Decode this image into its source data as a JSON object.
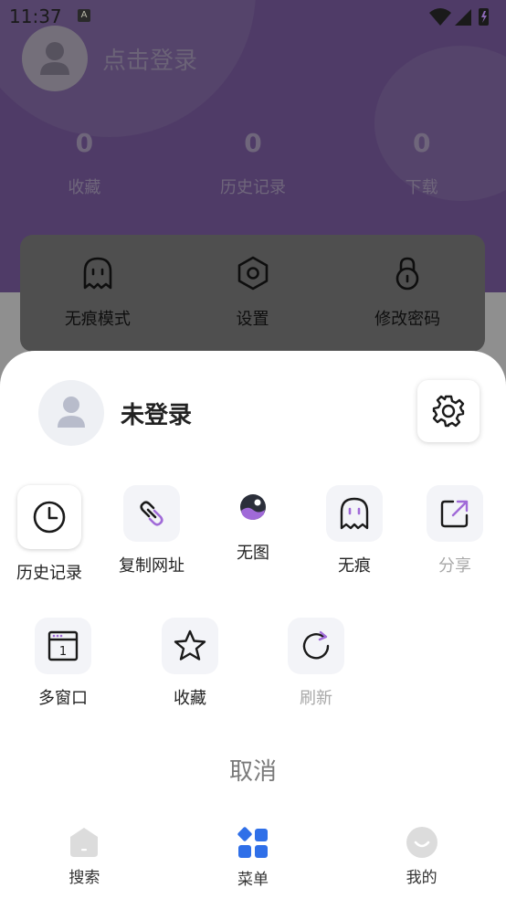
{
  "status_bar": {
    "time": "11:37",
    "notif": "A"
  },
  "profile": {
    "login_prompt": "点击登录"
  },
  "stats": [
    {
      "value": "0",
      "label": "收藏"
    },
    {
      "value": "0",
      "label": "历史记录"
    },
    {
      "value": "0",
      "label": "下载"
    }
  ],
  "quick_actions": [
    {
      "label": "无痕模式",
      "icon": "ghost-icon"
    },
    {
      "label": "设置",
      "icon": "hexagon-settings-icon"
    },
    {
      "label": "修改密码",
      "icon": "lock-icon"
    }
  ],
  "sheet": {
    "user_label": "未登录",
    "items_row1": [
      {
        "label": "历史记录",
        "icon": "clock-icon",
        "enabled": true
      },
      {
        "label": "复制网址",
        "icon": "link-icon",
        "enabled": true
      },
      {
        "label": "无图",
        "icon": "no-image-icon",
        "enabled": true
      },
      {
        "label": "无痕",
        "icon": "ghost-icon",
        "enabled": true
      },
      {
        "label": "分享",
        "icon": "share-icon",
        "enabled": false
      }
    ],
    "items_row2": [
      {
        "label": "多窗口",
        "icon": "multi-window-icon",
        "badge": "1",
        "enabled": true
      },
      {
        "label": "收藏",
        "icon": "star-icon",
        "enabled": true
      },
      {
        "label": "刷新",
        "icon": "refresh-icon",
        "enabled": false
      }
    ],
    "cancel_label": "取消"
  },
  "tabs": [
    {
      "label": "搜索",
      "icon": "home-icon"
    },
    {
      "label": "菜单",
      "icon": "menu-grid-icon",
      "active": true
    },
    {
      "label": "我的",
      "icon": "smile-icon"
    }
  ],
  "colors": {
    "header": "#8d6ab8",
    "accent_purple": "#a06ad8",
    "tab_active": "#2f6fe8"
  }
}
